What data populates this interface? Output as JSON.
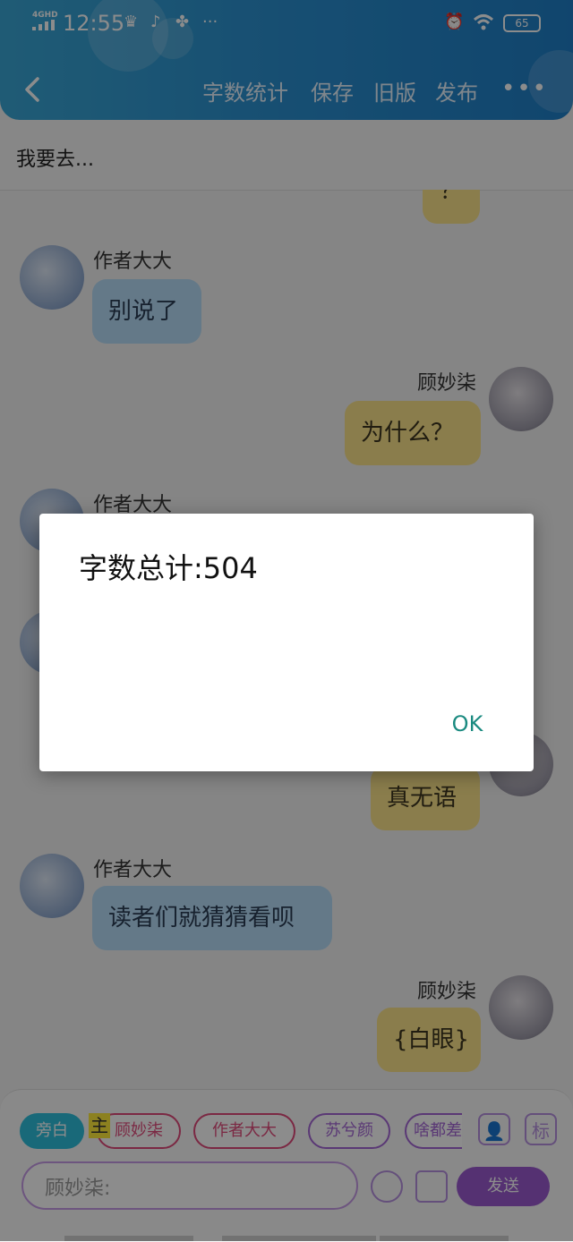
{
  "status_bar": {
    "network": "4GHD",
    "time": "12:55",
    "more": "···",
    "battery": "65"
  },
  "header": {
    "back_icon": "chevron-left-icon",
    "actions": [
      "字数统计",
      "保存",
      "旧版",
      "发布"
    ],
    "more": "•••"
  },
  "subtitle": "我要去...",
  "messages": [
    {
      "side": "right",
      "sender": "",
      "text": "？"
    },
    {
      "side": "left",
      "sender": "作者大大",
      "text": "别说了"
    },
    {
      "side": "right",
      "sender": "顾妙柒",
      "text": "为什么？"
    },
    {
      "side": "left",
      "sender": "作者大大",
      "text": ""
    },
    {
      "side": "right",
      "sender": "",
      "text": "真无语"
    },
    {
      "side": "left",
      "sender": "作者大大",
      "text": "读者们就猜猜看呗"
    },
    {
      "side": "right",
      "sender": "顾妙柒",
      "text": "{白眼}"
    }
  ],
  "bottom": {
    "narrator_chip": "旁白",
    "main_tag": "主",
    "chips": [
      "顾妙柒",
      "作者大大",
      "苏兮颜",
      "啥都差"
    ],
    "tool_mark": "标",
    "input_value": "顾妙柒:",
    "send_label": "发送"
  },
  "dialog": {
    "title": "字数总计:504",
    "ok_label": "OK"
  },
  "colors": {
    "header": "#2a8fd0",
    "left_bubble": "#b7dcf7",
    "right_bubble": "#fbe38a",
    "send": "#9b59d0",
    "ok": "#1a8a80"
  }
}
